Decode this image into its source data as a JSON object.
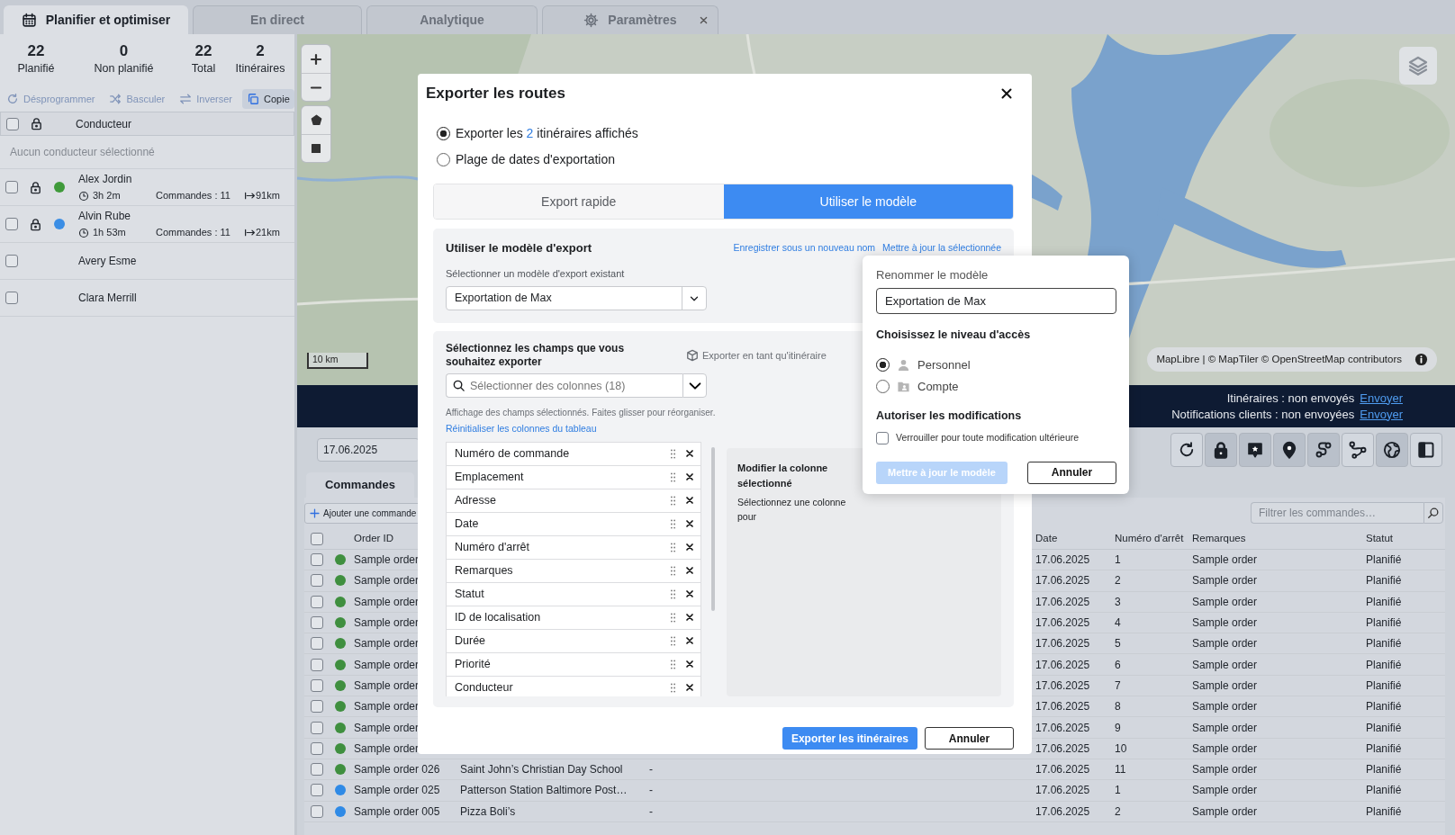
{
  "tabs": [
    {
      "label": "Planifier et optimiser",
      "selected": true,
      "closable": false
    },
    {
      "label": "En direct",
      "selected": false,
      "closable": false
    },
    {
      "label": "Analytique",
      "selected": false,
      "closable": false
    },
    {
      "label": "Paramètres",
      "selected": false,
      "closable": true
    }
  ],
  "stats": [
    {
      "value": "22",
      "label": "Planifié"
    },
    {
      "value": "0",
      "label": "Non planifié"
    },
    {
      "value": "22",
      "label": "Total"
    },
    {
      "value": "2",
      "label": "Itinéraires"
    }
  ],
  "driver_actions": [
    {
      "label": "Désprogrammer",
      "disabled": true
    },
    {
      "label": "Basculer",
      "disabled": true
    },
    {
      "label": "Inverser",
      "disabled": true
    },
    {
      "label": "Copie",
      "disabled": false
    }
  ],
  "drivers": {
    "all_checked": false,
    "column": "Conducteur",
    "empty_message": "Aucun conducteur sélectionné",
    "rows": [
      {
        "name": "Alex Jordin",
        "checked": false,
        "locked": true,
        "color": "#3f9a3a",
        "duration": "3h 2m",
        "orders": "Commandes : 11",
        "distance": "91km"
      },
      {
        "name": "Alvin Rube",
        "checked": false,
        "locked": true,
        "color": "#3b8ee5",
        "duration": "1h 53m",
        "orders": "Commandes : 11",
        "distance": "21km"
      },
      {
        "name": "Avery Esme",
        "checked": false,
        "locked": false
      },
      {
        "name": "Clara Merrill",
        "checked": false,
        "locked": false
      }
    ]
  },
  "map": {
    "scale": "10 km",
    "attribution": "MapLibre | © MapTiler © OpenStreetMap contributors"
  },
  "status_bar": [
    {
      "text": "Itinéraires : non envoyés",
      "link": "Envoyer"
    },
    {
      "text": "Notifications clients : non envoyées",
      "link": "Envoyer"
    }
  ],
  "date_field": {
    "value": "17.06.2025"
  },
  "tools": [
    {
      "on": false
    },
    {
      "on": true
    },
    {
      "on": true
    },
    {
      "on": true
    },
    {
      "on": true
    },
    {
      "on": false
    },
    {
      "on": true
    },
    {
      "on": false
    }
  ],
  "orders_tabs": [
    {
      "label": "Commandes",
      "selected": true
    }
  ],
  "add_order_button": "Ajouter une commande",
  "filter": {
    "placeholder": "Filtrer les commandes…"
  },
  "orders": {
    "all_checked": false,
    "headers": {
      "order_id": "Order ID",
      "date": "Date",
      "stop": "Numéro d'arrêt",
      "remarks": "Remarques",
      "status": "Statut"
    },
    "rows": [
      {
        "checked": false,
        "color": "#3f8f3f",
        "order_id": "Sample order",
        "date": "17.06.2025",
        "stop": "1",
        "remarks": "Sample order",
        "status": "Planifié"
      },
      {
        "checked": false,
        "color": "#3f8f3f",
        "order_id": "Sample order",
        "date": "17.06.2025",
        "stop": "2",
        "remarks": "Sample order",
        "status": "Planifié"
      },
      {
        "checked": false,
        "color": "#3f8f3f",
        "order_id": "Sample order",
        "date": "17.06.2025",
        "stop": "3",
        "remarks": "Sample order",
        "status": "Planifié"
      },
      {
        "checked": false,
        "color": "#3f8f3f",
        "order_id": "Sample order",
        "date": "17.06.2025",
        "stop": "4",
        "remarks": "Sample order",
        "status": "Planifié"
      },
      {
        "checked": false,
        "color": "#3f8f3f",
        "order_id": "Sample order",
        "date": "17.06.2025",
        "stop": "5",
        "remarks": "Sample order",
        "status": "Planifié"
      },
      {
        "checked": false,
        "color": "#3f8f3f",
        "order_id": "Sample order",
        "date": "17.06.2025",
        "stop": "6",
        "remarks": "Sample order",
        "status": "Planifié"
      },
      {
        "checked": false,
        "color": "#3f8f3f",
        "order_id": "Sample order",
        "date": "17.06.2025",
        "stop": "7",
        "remarks": "Sample order",
        "status": "Planifié"
      },
      {
        "checked": false,
        "color": "#3f8f3f",
        "order_id": "Sample order",
        "date": "17.06.2025",
        "stop": "8",
        "remarks": "Sample order",
        "status": "Planifié"
      },
      {
        "checked": false,
        "color": "#3f8f3f",
        "order_id": "Sample order",
        "date": "17.06.2025",
        "stop": "9",
        "remarks": "Sample order",
        "status": "Planifié"
      },
      {
        "checked": false,
        "color": "#3f8f3f",
        "order_id": "Sample order",
        "date": "17.06.2025",
        "stop": "10",
        "remarks": "Sample order",
        "status": "Planifié"
      },
      {
        "checked": false,
        "color": "#3f8f3f",
        "order_id": "Sample order 026",
        "column_2": "Saint John’s Christian Day School",
        "column_3": "-",
        "date": "17.06.2025",
        "stop": "11",
        "remarks": "Sample order",
        "status": "Planifié"
      },
      {
        "checked": false,
        "color": "#2f8ae6",
        "order_id": "Sample order 025",
        "column_2": "Patterson Station Baltimore Post…",
        "column_3": "-",
        "date": "17.06.2025",
        "stop": "1",
        "remarks": "Sample order",
        "status": "Planifié"
      },
      {
        "checked": false,
        "color": "#2f8ae6",
        "order_id": "Sample order 005",
        "column_2": "Pizza Boli’s",
        "column_3": "-",
        "date": "17.06.2025",
        "stop": "2",
        "remarks": "Sample order",
        "status": "Planifié"
      }
    ]
  },
  "export_dialog": {
    "title": "Exporter les routes",
    "scope_options": [
      {
        "parts": [
          "Exporter les ",
          "2",
          " itinéraires affichés"
        ],
        "selected": true
      },
      {
        "parts": [
          "Plage de dates d'exportation"
        ],
        "selected": false
      }
    ],
    "modes": [
      {
        "label": "Export rapide",
        "selected": false
      },
      {
        "label": "Utiliser le modèle",
        "selected": true
      }
    ],
    "template": {
      "title": "Utiliser le modèle d'export",
      "links": [
        "Enregistrer sous un nouveau nom",
        "Mettre à jour la sélectionnée"
      ],
      "select_label": "Sélectionner un modèle d'export existant",
      "select_value": "Exportation de Max"
    },
    "fields": {
      "title": "Sélectionnez les champs que vous souhaitez exporter",
      "export_as_route": "Exporter en tant qu'itinéraire",
      "column_select_placeholder": "Sélectionner des colonnes (18)",
      "hint": "Affichage des champs sélectionnés. Faites glisser pour réorganiser.",
      "reset_link": "Réinitialiser les colonnes du tableau",
      "items": [
        "Numéro de commande",
        "Emplacement",
        "Adresse",
        "Date",
        "Numéro d'arrêt",
        "Remarques",
        "Statut",
        "ID de localisation",
        "Durée",
        "Priorité",
        "Conducteur"
      ],
      "edit_title": "Modifier la colonne sélectionné",
      "edit_text": "Sélectionnez une colonne pour"
    },
    "buttons": [
      {
        "label": "Exporter les itinéraires",
        "kind": "primary"
      },
      {
        "label": "Annuler",
        "kind": "secondary"
      }
    ]
  },
  "rename_popup": {
    "title": "Renommer le modèle",
    "value": "Exportation de Max",
    "access_title": "Choisissez le niveau d'accès",
    "access_options": [
      {
        "label": "Personnel",
        "selected": true
      },
      {
        "label": "Compte",
        "selected": false
      }
    ],
    "edit_title": "Autoriser les modifications",
    "lock_option": {
      "label": "Verrouiller pour toute modification ultérieure",
      "checked": false
    },
    "buttons": [
      {
        "label": "Mettre à jour le modèle",
        "kind": "primary",
        "disabled": true
      },
      {
        "label": "Annuler",
        "kind": "secondary",
        "disabled": false
      }
    ]
  }
}
